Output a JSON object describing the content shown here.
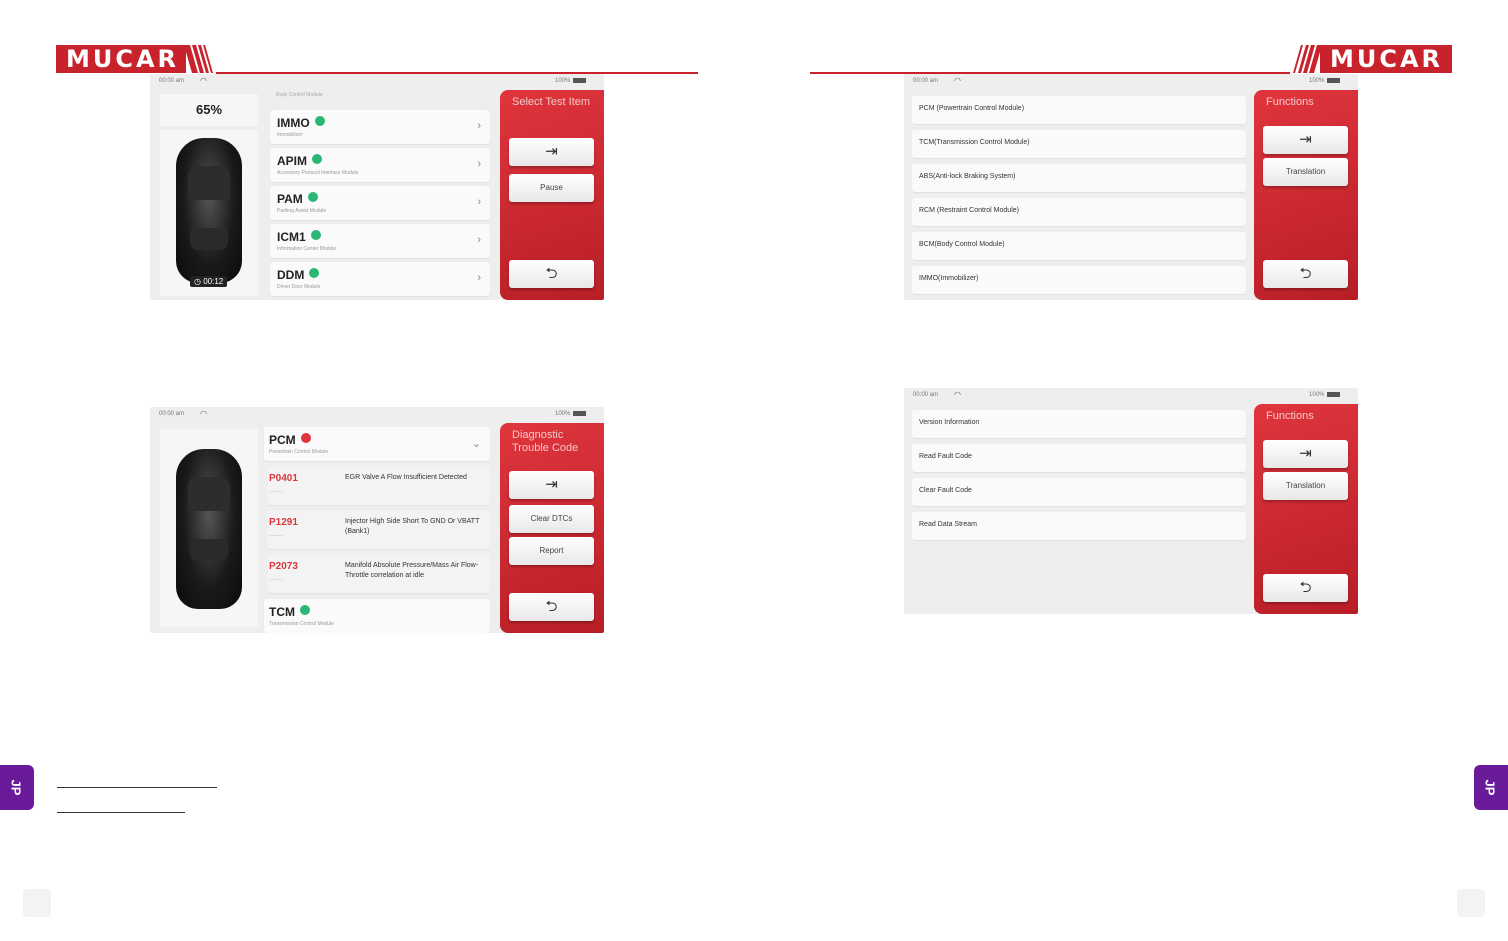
{
  "brand": {
    "name": "MUCAR",
    "color": "#c8232c"
  },
  "status": {
    "time": "00:00 am",
    "battery": "100%"
  },
  "screen_modules": {
    "percent": "65%",
    "timer": "00:12",
    "header_text": "Body Control Module",
    "panel_title": "Select Test Item",
    "buttons": {
      "exit_icon": "⇥",
      "pause": "Pause",
      "back_icon": "⮌"
    },
    "modules": [
      {
        "name": "IMMO",
        "sub": "Immobilizer"
      },
      {
        "name": "APIM",
        "sub": "Accessory Protocol Interface Module"
      },
      {
        "name": "PAM",
        "sub": "Parking Assist Module"
      },
      {
        "name": "ICM1",
        "sub": "Information Center Module"
      },
      {
        "name": "DDM",
        "sub": "Driver Door Module"
      }
    ]
  },
  "screen_dtc": {
    "panel_title": "Diagnostic Trouble Code",
    "buttons": {
      "exit_icon": "⇥",
      "clear": "Clear DTCs",
      "report": "Report",
      "back_icon": "⮌"
    },
    "header_module": {
      "name": "PCM",
      "sub": "Powertrain Control Module"
    },
    "codes": [
      {
        "code": "P0401",
        "dash": "-------",
        "desc": "EGR Valve A Flow Insufficient Detected"
      },
      {
        "code": "P1291",
        "dash": "-------",
        "desc": "Injector High Side Short To GND Or VBATT (Bank1)"
      },
      {
        "code": "P2073",
        "dash": "-------",
        "desc": "Manifold Absolute Pressure/Mass Air Flow-Throttle correlation at idle"
      }
    ],
    "footer_module": {
      "name": "TCM",
      "sub": "Transmission Control Module"
    }
  },
  "screen_systems": {
    "panel_title": "Functions",
    "buttons": {
      "exit_icon": "⇥",
      "translation": "Translation",
      "back_icon": "⮌"
    },
    "items": [
      "PCM (Powertrain Control Module)",
      "TCM(Transmission Control Module)",
      "ABS(Anti-lock Braking System)",
      "RCM (Restraint Control Module)",
      "BCM(Body Control Module)",
      "IMMO(Immobilizer)"
    ]
  },
  "screen_functions": {
    "panel_title": "Functions",
    "buttons": {
      "exit_icon": "⇥",
      "translation": "Translation",
      "back_icon": "⮌"
    },
    "items": [
      "Version Information",
      "Read Fault Code",
      "Clear Fault Code",
      "Read Data Stream"
    ]
  },
  "side_tab": "JP"
}
